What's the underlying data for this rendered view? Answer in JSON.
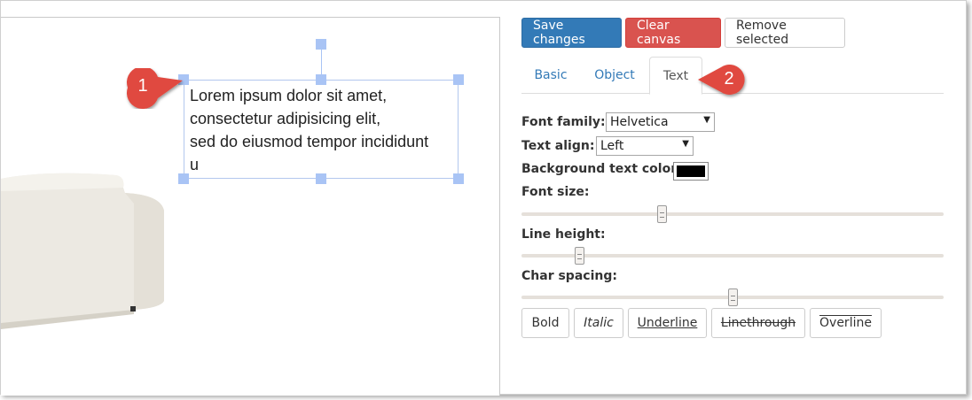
{
  "canvas": {
    "textbox_lines": [
      "Lorem ipsum dolor sit amet,",
      "consectetur adipisicing elit,",
      "sed do eiusmod tempor incididunt",
      "u"
    ]
  },
  "callouts": {
    "first": "1",
    "second": "2",
    "color": "#e04a3f"
  },
  "toolbar": {
    "save_label": "Save changes",
    "clear_label": "Clear canvas",
    "remove_label": "Remove selected"
  },
  "tabs": {
    "basic": "Basic",
    "object": "Object",
    "text": "Text",
    "active": "Text"
  },
  "text_panel": {
    "font_family_label": "Font family:",
    "font_family_value": "Helvetica",
    "text_align_label": "Text align:",
    "text_align_value": "Left",
    "bg_color_label": "Background text color:",
    "bg_color_value": "#000000",
    "font_size_label": "Font size:",
    "font_size_fraction": 0.33,
    "line_height_label": "Line height:",
    "line_height_fraction": 0.13,
    "char_spacing_label": "Char spacing:",
    "char_spacing_fraction": 0.5
  },
  "format_buttons": {
    "bold": "Bold",
    "italic": "Italic",
    "underline": "Underline",
    "linethrough": "Linethrough",
    "overline": "Overline"
  },
  "colors": {
    "primary": "#337ab7",
    "danger": "#d9534f",
    "selection": "#a9c4f5"
  }
}
